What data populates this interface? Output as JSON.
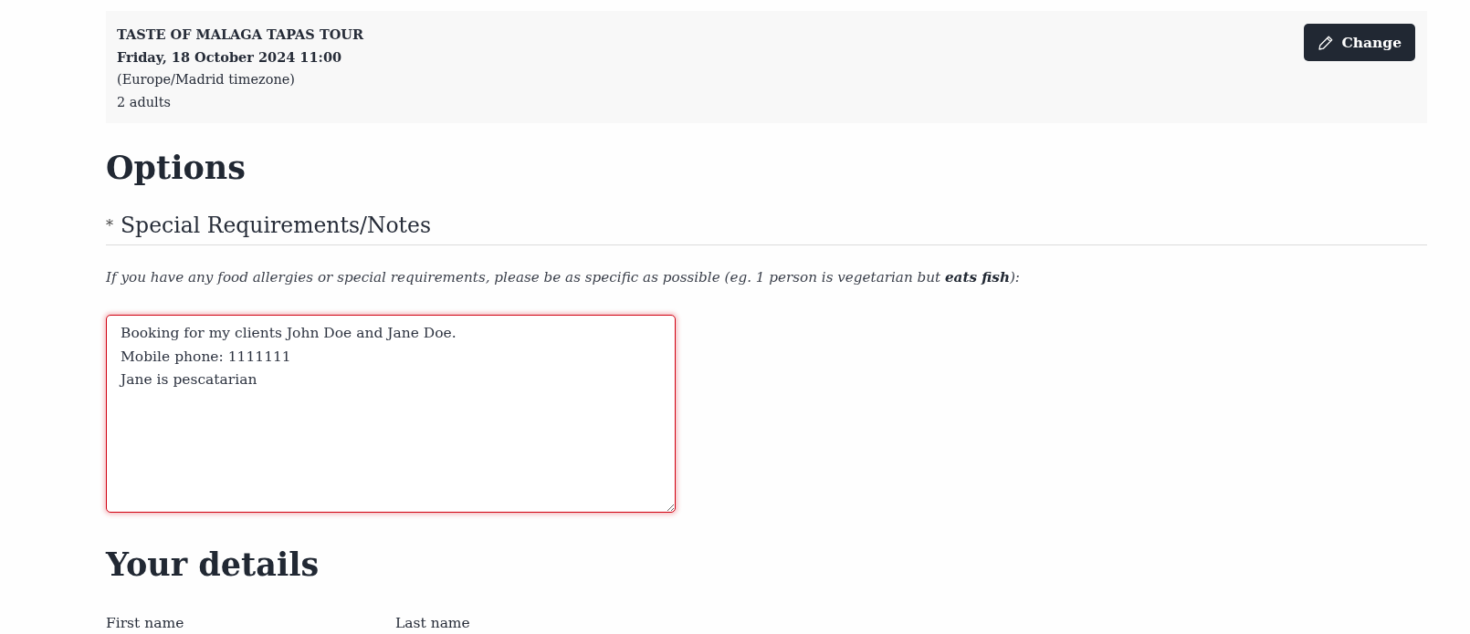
{
  "booking": {
    "title": "TASTE OF MALAGA TAPAS TOUR",
    "date": "Friday, 18 October 2024 11:00",
    "timezone": "(Europe/Madrid timezone)",
    "guests": "2 adults",
    "change_button": "Change"
  },
  "options": {
    "heading": "Options",
    "fields": [
      {
        "required_mark": "*",
        "label": "Special Requirements/Notes",
        "help": "If you have any food allergies or special requirements, please be as specific as possible (eg. 1 person is vegetarian but **eats fish**):",
        "value": "Booking for my clients John Doe and Jane Doe.\nMobile phone: 1111111\nJane is pescatarian",
        "invalid": true
      }
    ]
  },
  "your_details": {
    "heading": "Your details",
    "fields": [
      {
        "label": "First name"
      },
      {
        "label": "Last name"
      }
    ]
  }
}
